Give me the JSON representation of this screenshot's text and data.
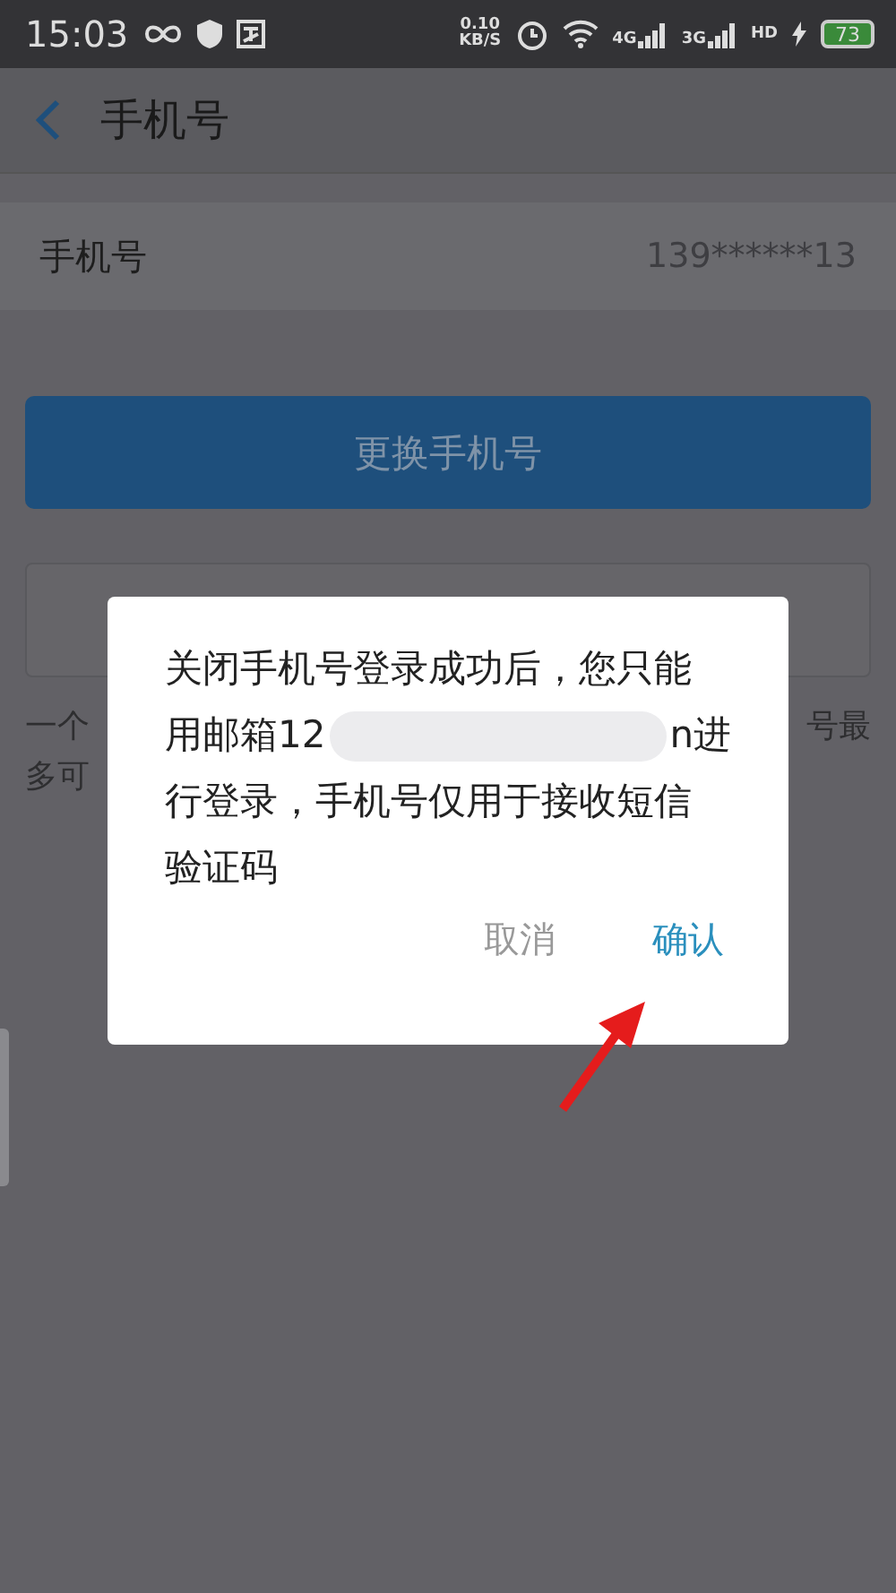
{
  "status_bar": {
    "time": "15:03",
    "speed_value": "0.10",
    "speed_unit": "KB/S",
    "network_4g": "4G",
    "network_3g": "3G",
    "hd": "HD",
    "battery": "73"
  },
  "header": {
    "title": "手机号"
  },
  "phone_row": {
    "label": "手机号",
    "value": "139******13"
  },
  "change_button": {
    "label": "更换手机号"
  },
  "hint": {
    "line1_left": "一个",
    "line1_right": "号最",
    "line2_left": "多可"
  },
  "dialog": {
    "lines": [
      {
        "kind": "text",
        "text": "关闭手机号登录成功后，您只能"
      },
      {
        "kind": "redacted",
        "before": "用邮箱12",
        "after": "n进"
      },
      {
        "kind": "text",
        "text": "行登录，手机号仅用于接收短信"
      },
      {
        "kind": "text",
        "text": "验证码"
      }
    ],
    "buttons": [
      {
        "label": "取消",
        "kind": "cancel"
      },
      {
        "label": "确认",
        "kind": "confirm"
      }
    ]
  }
}
